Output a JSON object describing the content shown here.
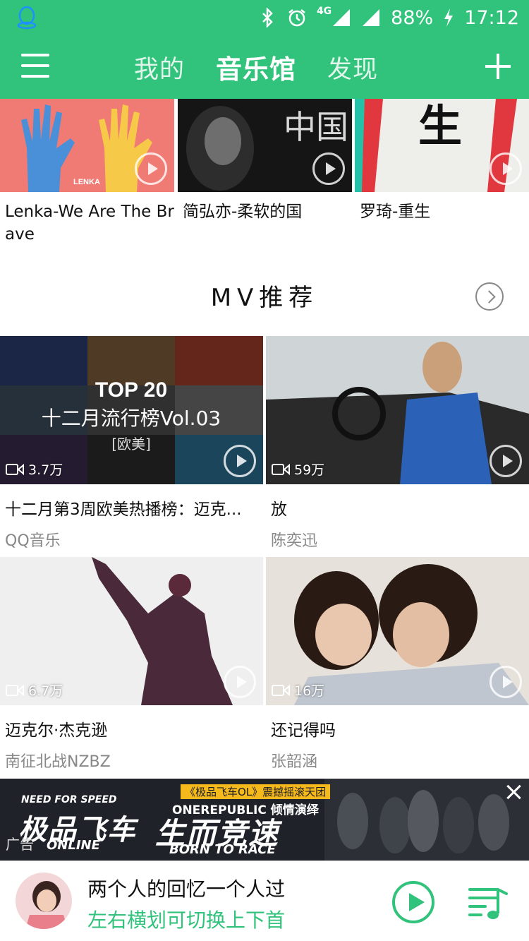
{
  "status_bar": {
    "network": "4G",
    "battery": "88%",
    "time": "17:12",
    "icons": [
      "qq-icon",
      "bluetooth-icon",
      "alarm-icon",
      "signal-icon",
      "charging-icon"
    ]
  },
  "header": {
    "tabs": [
      {
        "label": "我的",
        "active": false
      },
      {
        "label": "音乐馆",
        "active": true
      },
      {
        "label": "发现",
        "active": false
      }
    ]
  },
  "albums": [
    {
      "title": "Lenka-We Are The Brave",
      "cover_text": "LENKA"
    },
    {
      "title": "简弘亦-柔软的国",
      "cover_text": "中国"
    },
    {
      "title": "罗琦-重生",
      "cover_text": "生"
    }
  ],
  "mv_section": {
    "title": "MV推荐",
    "items": [
      {
        "title": "十二月第3周欧美热播榜：迈克...",
        "artist": "QQ音乐",
        "views": "3.7万",
        "overlay_title": "TOP 20",
        "overlay_sub": "十二月流行榜Vol.03",
        "overlay_tag": "[欧美]"
      },
      {
        "title": "放",
        "artist": "陈奕迅",
        "views": "59万"
      },
      {
        "title": "迈克尔·杰克逊",
        "artist": "南征北战NZBZ",
        "views": "6.7万"
      },
      {
        "title": "还记得吗",
        "artist": "张韶涵",
        "views": "16万"
      }
    ]
  },
  "ad": {
    "label": "广告",
    "brand_top": "NEED FOR SPEED",
    "brand_main": "极品飞车",
    "brand_sub": "ONLINE",
    "tag": "《极品飞车OL》震撼摇滚天团",
    "band": "ONEREPUBLIC 倾情演绎",
    "slogan": "生而竞速",
    "tour": "BORN TO RACE"
  },
  "player": {
    "song": "两个人的回忆一个人过",
    "hint": "左右横划可切换上下首"
  },
  "colors": {
    "accent": "#31c27c",
    "muted": "#888888"
  }
}
